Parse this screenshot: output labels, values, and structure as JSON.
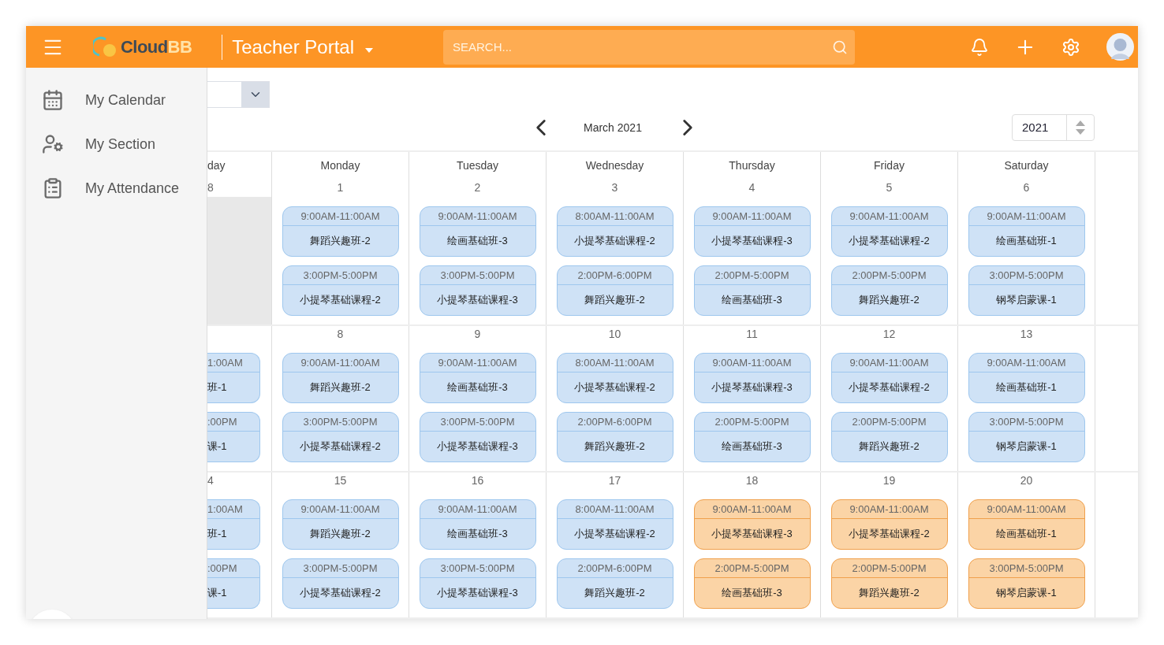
{
  "header": {
    "logo": {
      "main": "Cloud",
      "accent": "BB"
    },
    "portal_title": "Teacher Portal",
    "search": {
      "placeholder": "SEARCH..."
    }
  },
  "sidebar": {
    "items": [
      {
        "label": "My Calendar",
        "kind": "calendar"
      },
      {
        "label": "My Section",
        "kind": "section"
      },
      {
        "label": "My Attendance",
        "kind": "attendance"
      }
    ]
  },
  "calendar": {
    "month_label": "March 2021",
    "year": "2021",
    "weekdays": [
      "day",
      "Monday",
      "Tuesday",
      "Wednesday",
      "Thursday",
      "Friday",
      "Saturday"
    ],
    "weeks": [
      {
        "days": [
          {
            "date": "8",
            "outside_month": true
          },
          {
            "date": "1",
            "outside_month": false,
            "events": [
              {
                "time": "9:00AM-11:00AM",
                "name": "舞蹈兴趣班-2",
                "highlighted": false
              },
              {
                "time": "3:00PM-5:00PM",
                "name": "小提琴基础课程-2",
                "highlighted": false
              }
            ]
          },
          {
            "date": "2",
            "outside_month": false,
            "events": [
              {
                "time": "9:00AM-11:00AM",
                "name": "绘画基础班-3",
                "highlighted": false
              },
              {
                "time": "3:00PM-5:00PM",
                "name": "小提琴基础课程-3",
                "highlighted": false
              }
            ]
          },
          {
            "date": "3",
            "outside_month": false,
            "events": [
              {
                "time": "8:00AM-11:00AM",
                "name": "小提琴基础课程-2",
                "highlighted": false
              },
              {
                "time": "2:00PM-6:00PM",
                "name": "舞蹈兴趣班-2",
                "highlighted": false
              }
            ]
          },
          {
            "date": "4",
            "outside_month": false,
            "events": [
              {
                "time": "9:00AM-11:00AM",
                "name": "小提琴基础课程-3",
                "highlighted": false
              },
              {
                "time": "2:00PM-5:00PM",
                "name": "绘画基础班-3",
                "highlighted": false
              }
            ]
          },
          {
            "date": "5",
            "outside_month": false,
            "events": [
              {
                "time": "9:00AM-11:00AM",
                "name": "小提琴基础课程-2",
                "highlighted": false
              },
              {
                "time": "2:00PM-5:00PM",
                "name": "舞蹈兴趣班-2",
                "highlighted": false
              }
            ]
          },
          {
            "date": "6",
            "outside_month": false,
            "events": [
              {
                "time": "9:00AM-11:00AM",
                "name": "绘画基础班-1",
                "highlighted": false
              },
              {
                "time": "3:00PM-5:00PM",
                "name": "钢琴启蒙课-1",
                "highlighted": false
              }
            ]
          }
        ]
      },
      {
        "days": [
          {
            "outside_month": false,
            "events": [
              {
                "time": "1:00AM",
                "name": "班-1",
                "highlighted": false
              },
              {
                "time": ":00PM",
                "name": "课-1",
                "highlighted": false
              }
            ]
          },
          {
            "date": "8",
            "outside_month": false,
            "events": [
              {
                "time": "9:00AM-11:00AM",
                "name": "舞蹈兴趣班-2",
                "highlighted": false
              },
              {
                "time": "3:00PM-5:00PM",
                "name": "小提琴基础课程-2",
                "highlighted": false
              }
            ]
          },
          {
            "date": "9",
            "outside_month": false,
            "events": [
              {
                "time": "9:00AM-11:00AM",
                "name": "绘画基础班-3",
                "highlighted": false
              },
              {
                "time": "3:00PM-5:00PM",
                "name": "小提琴基础课程-3",
                "highlighted": false
              }
            ]
          },
          {
            "date": "10",
            "outside_month": false,
            "events": [
              {
                "time": "8:00AM-11:00AM",
                "name": "小提琴基础课程-2",
                "highlighted": false
              },
              {
                "time": "2:00PM-6:00PM",
                "name": "舞蹈兴趣班-2",
                "highlighted": false
              }
            ]
          },
          {
            "date": "11",
            "outside_month": false,
            "events": [
              {
                "time": "9:00AM-11:00AM",
                "name": "小提琴基础课程-3",
                "highlighted": false
              },
              {
                "time": "2:00PM-5:00PM",
                "name": "绘画基础班-3",
                "highlighted": false
              }
            ]
          },
          {
            "date": "12",
            "outside_month": false,
            "events": [
              {
                "time": "9:00AM-11:00AM",
                "name": "小提琴基础课程-2",
                "highlighted": false
              },
              {
                "time": "2:00PM-5:00PM",
                "name": "舞蹈兴趣班-2",
                "highlighted": false
              }
            ]
          },
          {
            "date": "13",
            "outside_month": false,
            "events": [
              {
                "time": "9:00AM-11:00AM",
                "name": "绘画基础班-1",
                "highlighted": false
              },
              {
                "time": "3:00PM-5:00PM",
                "name": "钢琴启蒙课-1",
                "highlighted": false
              }
            ]
          }
        ]
      },
      {
        "days": [
          {
            "date": "4",
            "outside_month": false,
            "events": [
              {
                "time": "1:00AM",
                "name": "班-1",
                "highlighted": false
              },
              {
                "time": ":00PM",
                "name": "课-1",
                "highlighted": false
              }
            ]
          },
          {
            "date": "15",
            "outside_month": false,
            "events": [
              {
                "time": "9:00AM-11:00AM",
                "name": "舞蹈兴趣班-2",
                "highlighted": false
              },
              {
                "time": "3:00PM-5:00PM",
                "name": "小提琴基础课程-2",
                "highlighted": false
              }
            ]
          },
          {
            "date": "16",
            "outside_month": false,
            "events": [
              {
                "time": "9:00AM-11:00AM",
                "name": "绘画基础班-3",
                "highlighted": false
              },
              {
                "time": "3:00PM-5:00PM",
                "name": "小提琴基础课程-3",
                "highlighted": false
              }
            ]
          },
          {
            "date": "17",
            "outside_month": false,
            "events": [
              {
                "time": "8:00AM-11:00AM",
                "name": "小提琴基础课程-2",
                "highlighted": false
              },
              {
                "time": "2:00PM-6:00PM",
                "name": "舞蹈兴趣班-2",
                "highlighted": false
              }
            ]
          },
          {
            "date": "18",
            "outside_month": false,
            "events": [
              {
                "time": "9:00AM-11:00AM",
                "name": "小提琴基础课程-3",
                "highlighted": true
              },
              {
                "time": "2:00PM-5:00PM",
                "name": "绘画基础班-3",
                "highlighted": true
              }
            ]
          },
          {
            "date": "19",
            "outside_month": false,
            "events": [
              {
                "time": "9:00AM-11:00AM",
                "name": "小提琴基础课程-2",
                "highlighted": true
              },
              {
                "time": "2:00PM-5:00PM",
                "name": "舞蹈兴趣班-2",
                "highlighted": true
              }
            ]
          },
          {
            "date": "20",
            "outside_month": false,
            "events": [
              {
                "time": "9:00AM-11:00AM",
                "name": "绘画基础班-1",
                "highlighted": true
              },
              {
                "time": "3:00PM-5:00PM",
                "name": "钢琴启蒙课-1",
                "highlighted": true
              }
            ]
          }
        ]
      }
    ]
  }
}
